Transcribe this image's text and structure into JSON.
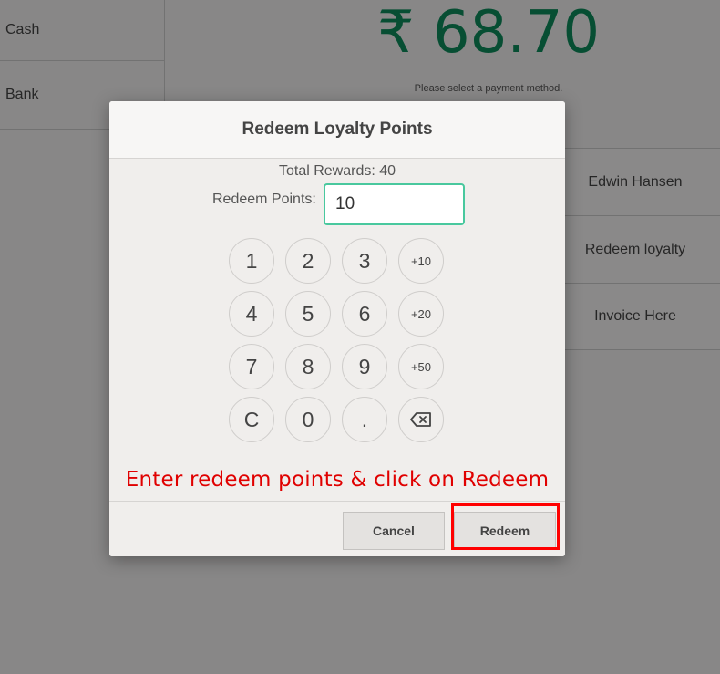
{
  "payment_methods": [
    "Cash",
    "Bank"
  ],
  "amount": "₹ 68.70",
  "hint": "Please select a payment method.",
  "actions": [
    "Edwin Hansen",
    "Redeem loyalty",
    "Invoice Here"
  ],
  "modal": {
    "title": "Redeem Loyalty Points",
    "total_rewards": "Total Rewards: 40",
    "redeem_label": "Redeem Points:",
    "redeem_value": "10",
    "keypad": [
      "1",
      "2",
      "3",
      "+10",
      "4",
      "5",
      "6",
      "+20",
      "7",
      "8",
      "9",
      "+50",
      "C",
      "0",
      ".",
      "⌫"
    ],
    "instruction": "Enter redeem points & click on Redeem",
    "cancel_label": "Cancel",
    "redeem_button_label": "Redeem"
  },
  "colors": {
    "amount": "#0d8a5a",
    "input_border": "#49c89e",
    "instruction": "#e00000",
    "highlight": "#ff0000"
  }
}
